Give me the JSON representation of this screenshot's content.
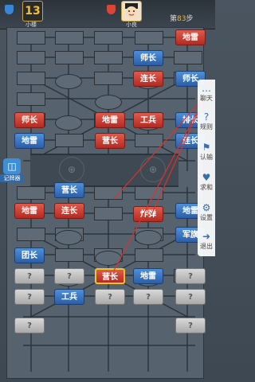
{
  "players": {
    "me_badge": "13",
    "me_name": "小楼",
    "opp_name": "小良"
  },
  "step": {
    "prefix": "第",
    "value": "83",
    "suffix": "步"
  },
  "recorder_label": "记牌器",
  "side_menu": [
    {
      "icon": "chat-icon",
      "glyph": "…",
      "label": "聊天"
    },
    {
      "icon": "rules-icon",
      "glyph": "?",
      "label": "规则"
    },
    {
      "icon": "flag-icon",
      "glyph": "⚑",
      "label": "认输"
    },
    {
      "icon": "handshake-icon",
      "glyph": "♥",
      "label": "求和"
    },
    {
      "icon": "gear-icon",
      "glyph": "⚙",
      "label": "设置"
    },
    {
      "icon": "exit-icon",
      "glyph": "➜",
      "label": "退出"
    }
  ],
  "colors": {
    "red": "#c8382d",
    "blue": "#3572c0",
    "gray": "#bbbbbb"
  },
  "pieces": [
    {
      "id": "p1",
      "side": "red",
      "label": "地雷"
    },
    {
      "id": "p2",
      "side": "blue",
      "label": "师长"
    },
    {
      "id": "p3",
      "side": "red",
      "label": "连长"
    },
    {
      "id": "p4",
      "side": "blue",
      "label": "师长"
    },
    {
      "id": "p5",
      "side": "red",
      "label": "师长"
    },
    {
      "id": "p6",
      "side": "red",
      "label": "地雷"
    },
    {
      "id": "p7",
      "side": "red",
      "label": "工兵"
    },
    {
      "id": "p8",
      "side": "blue",
      "label": "排长"
    },
    {
      "id": "p9",
      "side": "blue",
      "label": "地雷"
    },
    {
      "id": "p10",
      "side": "red",
      "label": "营长"
    },
    {
      "id": "p11",
      "side": "blue",
      "label": "连长"
    },
    {
      "id": "p12",
      "side": "blue",
      "label": "营长"
    },
    {
      "id": "p13",
      "side": "red",
      "label": "地雷"
    },
    {
      "id": "p14",
      "side": "red",
      "label": "连长"
    },
    {
      "id": "p15",
      "side": "red",
      "label": "炸弹"
    },
    {
      "id": "p16",
      "side": "blue",
      "label": "地雷"
    },
    {
      "id": "p17",
      "side": "blue",
      "label": "军旗"
    },
    {
      "id": "p18",
      "side": "blue",
      "label": "团长"
    },
    {
      "id": "p19",
      "side": "gray",
      "label": "?"
    },
    {
      "id": "p20",
      "side": "gray",
      "label": "?"
    },
    {
      "id": "p21",
      "side": "red",
      "label": "营长"
    },
    {
      "id": "p22",
      "side": "blue",
      "label": "地雷"
    },
    {
      "id": "p23",
      "side": "gray",
      "label": "?"
    },
    {
      "id": "p24",
      "side": "gray",
      "label": "?"
    },
    {
      "id": "p25",
      "side": "gray",
      "label": "?"
    },
    {
      "id": "p26",
      "side": "blue",
      "label": "工兵"
    },
    {
      "id": "p27",
      "side": "gray",
      "label": "?"
    },
    {
      "id": "p28",
      "side": "gray",
      "label": "?"
    },
    {
      "id": "p29",
      "side": "gray",
      "label": "?"
    },
    {
      "id": "p30",
      "side": "gray",
      "label": "?"
    }
  ]
}
